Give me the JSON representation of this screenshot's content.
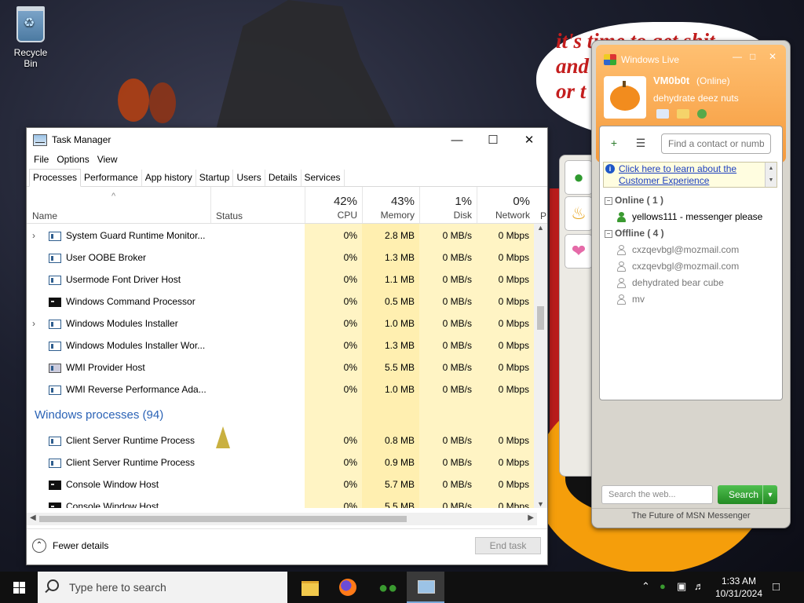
{
  "desktop": {
    "recycle_bin_label": "Recycle Bin",
    "speech_text": "it's time to get shit\nand\nor t"
  },
  "task_manager": {
    "title": "Task Manager",
    "menu": [
      "File",
      "Options",
      "View"
    ],
    "tabs": [
      "Processes",
      "Performance",
      "App history",
      "Startup",
      "Users",
      "Details",
      "Services"
    ],
    "active_tab": "Processes",
    "columns": {
      "name": "Name",
      "status": "Status",
      "cpu": {
        "pct": "42%",
        "label": "CPU"
      },
      "memory": {
        "pct": "43%",
        "label": "Memory"
      },
      "disk": {
        "pct": "1%",
        "label": "Disk"
      },
      "network": {
        "pct": "0%",
        "label": "Network"
      },
      "power": "P"
    },
    "rows": [
      {
        "name": "System Guard Runtime Monitor...",
        "expandable": true,
        "icon": "service-icon",
        "cpu": "0%",
        "memory": "2.8 MB",
        "disk": "0 MB/s",
        "network": "0 Mbps"
      },
      {
        "name": "User OOBE Broker",
        "expandable": false,
        "icon": "service-icon",
        "cpu": "0%",
        "memory": "1.3 MB",
        "disk": "0 MB/s",
        "network": "0 Mbps"
      },
      {
        "name": "Usermode Font Driver Host",
        "expandable": false,
        "icon": "service-icon",
        "cpu": "0%",
        "memory": "1.1 MB",
        "disk": "0 MB/s",
        "network": "0 Mbps"
      },
      {
        "name": "Windows Command Processor",
        "expandable": false,
        "icon": "console-icon",
        "cpu": "0%",
        "memory": "0.5 MB",
        "disk": "0 MB/s",
        "network": "0 Mbps"
      },
      {
        "name": "Windows Modules Installer",
        "expandable": true,
        "icon": "service-icon",
        "cpu": "0%",
        "memory": "1.0 MB",
        "disk": "0 MB/s",
        "network": "0 Mbps"
      },
      {
        "name": "Windows Modules Installer Wor...",
        "expandable": false,
        "icon": "service-icon",
        "cpu": "0%",
        "memory": "1.3 MB",
        "disk": "0 MB/s",
        "network": "0 Mbps"
      },
      {
        "name": "WMI Provider Host",
        "expandable": false,
        "icon": "wmi-icon",
        "cpu": "0%",
        "memory": "5.5 MB",
        "disk": "0 MB/s",
        "network": "0 Mbps"
      },
      {
        "name": "WMI Reverse Performance Ada...",
        "expandable": false,
        "icon": "service-icon",
        "cpu": "0%",
        "memory": "1.0 MB",
        "disk": "0 MB/s",
        "network": "0 Mbps"
      }
    ],
    "group_label": "Windows processes (94)",
    "rows2": [
      {
        "name": "Client Server Runtime Process",
        "expandable": false,
        "icon": "service-icon",
        "cpu": "0%",
        "memory": "0.8 MB",
        "disk": "0 MB/s",
        "network": "0 Mbps"
      },
      {
        "name": "Client Server Runtime Process",
        "expandable": false,
        "icon": "service-icon",
        "cpu": "0%",
        "memory": "0.9 MB",
        "disk": "0 MB/s",
        "network": "0 Mbps"
      },
      {
        "name": "Console Window Host",
        "expandable": false,
        "icon": "console-icon",
        "cpu": "0%",
        "memory": "5.7 MB",
        "disk": "0 MB/s",
        "network": "0 Mbps"
      },
      {
        "name": "Console Window Host",
        "expandable": false,
        "icon": "console-icon",
        "cpu": "0%",
        "memory": "5.5 MB",
        "disk": "0 MB/s",
        "network": "0 Mbps"
      }
    ],
    "fewer_details": "Fewer details",
    "end_task": "End task"
  },
  "msn": {
    "window_title": "Windows Live",
    "username": "VM0b0t",
    "status": "(Online)",
    "personal_message": "dehydrate deez nuts",
    "find_placeholder": "Find a contact or number...",
    "info_text": "Click here to learn about the Customer Experience",
    "online_group": "Online ( 1 )",
    "online_contacts": [
      "yellows111 - messenger please"
    ],
    "offline_group": "Offline ( 4 )",
    "offline_contacts": [
      "cxzqevbgl@mozmail.com",
      "cxzqevbgl@mozmail.com",
      "dehydrated bear cube",
      "mv"
    ],
    "search_placeholder": "Search the web...",
    "search_button": "Search",
    "footer": "The Future of MSN Messenger"
  },
  "taskbar": {
    "search_placeholder": "Type here to search",
    "apps": [
      "file-explorer-icon",
      "firefox-icon",
      "msn-messenger-icon",
      "task-manager-icon"
    ],
    "time": "1:33 AM",
    "date": "10/31/2024"
  }
}
